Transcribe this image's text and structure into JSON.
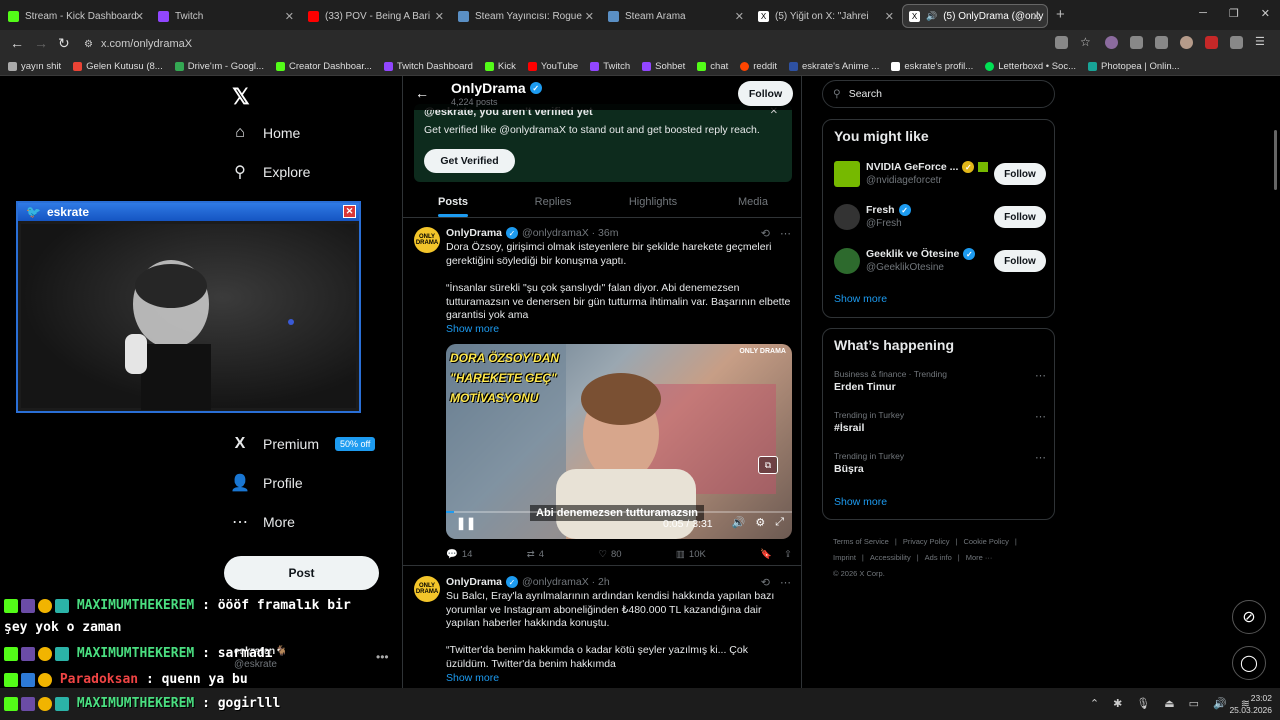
{
  "tabs": [
    {
      "title": "Stream - Kick Dashboard",
      "color": "#53fc18"
    },
    {
      "title": "Twitch",
      "color": "#9146ff"
    },
    {
      "title": "(33) POV - Being A Bari",
      "color": "#ff0000"
    },
    {
      "title": "Steam Yayıncısı: Rogue",
      "color": "#1b2838"
    },
    {
      "title": "Steam Arama",
      "color": "#1b2838"
    },
    {
      "title": "(5) Yiğit on X: \"Jahrei",
      "color": "#ffffff"
    },
    {
      "title": "(5) OnlyDrama (@only",
      "color": "#ffffff"
    }
  ],
  "url": "x.com/onlydramaX",
  "bookmarks": [
    {
      "label": "yayın shit",
      "color": "#aaaaaa"
    },
    {
      "label": "Gelen Kutusu (8...",
      "color": "#ea4335"
    },
    {
      "label": "Drive'ım - Googl...",
      "color": "#34a853"
    },
    {
      "label": "Creator Dashboar...",
      "color": "#53fc18"
    },
    {
      "label": "Twitch Dashboard",
      "color": "#9146ff"
    },
    {
      "label": "Kick",
      "color": "#53fc18"
    },
    {
      "label": "YouTube",
      "color": "#ff0000"
    },
    {
      "label": "Twitch",
      "color": "#9146ff"
    },
    {
      "label": "Sohbet",
      "color": "#9146ff"
    },
    {
      "label": "chat",
      "color": "#53fc18"
    },
    {
      "label": "reddit",
      "color": "#ff4500"
    },
    {
      "label": "eskrate's Anime ...",
      "color": "#2e51a2"
    },
    {
      "label": "eskrate's profil...",
      "color": "#ffffff"
    },
    {
      "label": "Letterboxd • Soc...",
      "color": "#00e054"
    },
    {
      "label": "Photopea | Onlin...",
      "color": "#18a497"
    }
  ],
  "nav": {
    "home": "Home",
    "explore": "Explore",
    "premium": "Premium",
    "premium_badge": "50% off",
    "profile": "Profile",
    "more": "More",
    "post": "Post",
    "account_name": "eskraten🐐",
    "account_handle": "@eskrate"
  },
  "webcam": {
    "title": "eskrate"
  },
  "chat": [
    {
      "user": "MAXIMUMTHEKEREM",
      "msg": ": öööf framalık bir"
    },
    {
      "user": "",
      "msg": "şey yok o zaman"
    },
    {
      "user": "MAXIMUMTHEKEREM",
      "msg": ": sarmadı"
    },
    {
      "user": "Paradoksan",
      "msg": ": quenn ya bu"
    },
    {
      "user": "MAXIMUMTHEKEREM",
      "msg": ": gogirlll"
    }
  ],
  "profile": {
    "name": "OnlyDrama",
    "posts_count": "4,224 posts",
    "follow": "Follow",
    "verify_title": "@eskrate, you aren't verified yet",
    "verify_text": "Get verified like @onlydramaX to stand out and get boosted reply reach.",
    "get_verified": "Get Verified",
    "tabs": [
      "Posts",
      "Replies",
      "Highlights",
      "Media"
    ]
  },
  "tweets": [
    {
      "name": "OnlyDrama",
      "handle": "@onlydramaX · 36m",
      "text1": "Dora Özsoy, girişimci olmak isteyenlere bir şekilde harekete geçmeleri gerektiğini söylediği bir konuşma yaptı.",
      "text2": "“İnsanlar sürekli \"şu çok şanslıydı\" falan diyor. Abi denemezsen tutturamazsın ve denersen bir gün tutturma ihtimalin var. Başarının elbette garantisi yok ama",
      "show_more": "Show more",
      "replies": "14",
      "reposts": "4",
      "likes": "80",
      "views": "10K"
    },
    {
      "name": "OnlyDrama",
      "handle": "@onlydramaX · 2h",
      "text1": "Su Balcı, Eray'la ayrılmalarının ardından kendisi hakkında yapılan bazı yorumlar ve Instagram aboneliğinden ₺480.000 TL kazandığına dair yapılan haberler hakkında konuştu.",
      "text2": "“Twitter'da benim hakkımda o kadar kötü şeyler yazılmış ki... Çok üzüldüm. Twitter'da benim hakkımda",
      "show_more": "Show more"
    }
  ],
  "video": {
    "title_lines": [
      "DORA ÖZSOY'DAN",
      "\"HAREKETE GEÇ\"",
      "MOTİVASYONU"
    ],
    "logo": "ONLY DRAMA",
    "caption": "Abi denemezsen tutturamazsın",
    "time": "0:05 / 3:31",
    "progress": 0.024
  },
  "right": {
    "search_placeholder": "Search",
    "might_like_title": "You might like",
    "suggestions": [
      {
        "name": "NVIDIA GeForce ...",
        "handle": "@nvidiageforcetr",
        "follow": "Follow",
        "color": "#76b900"
      },
      {
        "name": "Fresh",
        "handle": "@Fresh",
        "follow": "Follow",
        "color": "#333333"
      },
      {
        "name": "Geeklik ve Ötesine",
        "handle": "@GeeklikOtesine",
        "follow": "Follow",
        "color": "#2d6a2d"
      }
    ],
    "show_more": "Show more",
    "happening_title": "What’s happening",
    "trends": [
      {
        "context": "Business & finance · Trending",
        "topic": "Erden Timur"
      },
      {
        "context": "Trending in Turkey",
        "topic": "#İsrail"
      },
      {
        "context": "Trending in Turkey",
        "topic": "Büşra"
      }
    ],
    "footer": [
      "Terms of Service",
      "|",
      "Privacy Policy",
      "|",
      "Cookie Policy",
      "|",
      "Imprint",
      "|",
      "Accessibility",
      "|",
      "Ads info",
      "|",
      "More ···",
      "© 2026 X Corp."
    ]
  },
  "clock": {
    "time": "23:02",
    "date": "25.03.2026"
  }
}
